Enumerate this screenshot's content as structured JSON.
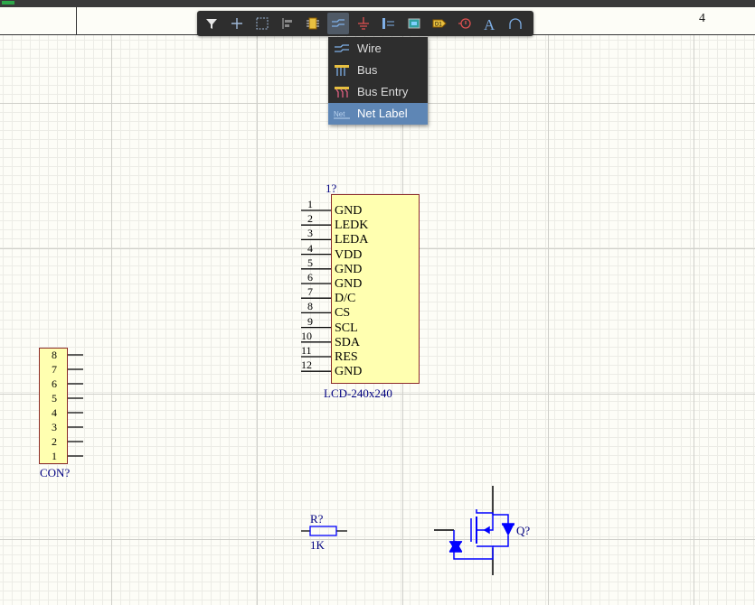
{
  "title_block": {
    "sheet_zone": "4"
  },
  "toolbar": {
    "buttons": [
      "filter-icon",
      "cross-icon",
      "select-rect-icon",
      "align-icon",
      "part-icon",
      "wire-icon",
      "gnd-icon",
      "port-icon",
      "sheet-icon",
      "netlabel-icon",
      "directive-icon",
      "text-icon",
      "arc-icon"
    ]
  },
  "wire_menu": {
    "items": [
      {
        "label": "Wire",
        "icon": "wire-icon"
      },
      {
        "label": "Bus",
        "icon": "bus-icon"
      },
      {
        "label": "Bus Entry",
        "icon": "bus-entry-icon"
      },
      {
        "label": "Net Label",
        "icon": "net-label-icon",
        "selected": true
      }
    ]
  },
  "lcd": {
    "designator": "1?",
    "comment": "LCD-240x240",
    "pins": [
      {
        "num": "1",
        "name": "GND"
      },
      {
        "num": "2",
        "name": "LEDK"
      },
      {
        "num": "3",
        "name": "LEDA"
      },
      {
        "num": "4",
        "name": "VDD"
      },
      {
        "num": "5",
        "name": "GND"
      },
      {
        "num": "6",
        "name": "GND"
      },
      {
        "num": "7",
        "name": "D/C"
      },
      {
        "num": "8",
        "name": "CS"
      },
      {
        "num": "9",
        "name": "SCL"
      },
      {
        "num": "10",
        "name": "SDA"
      },
      {
        "num": "11",
        "name": "RES"
      },
      {
        "num": "12",
        "name": "GND"
      }
    ]
  },
  "connector": {
    "designator": "CON?",
    "pins": [
      "8",
      "7",
      "6",
      "5",
      "4",
      "3",
      "2",
      "1"
    ]
  },
  "resistor": {
    "designator": "R?",
    "value": "1K"
  },
  "mosfet": {
    "designator": "Q?"
  },
  "colors": {
    "component_text": "#000080",
    "body_fill": "#ffffb0",
    "body_border": "#8b2a2a",
    "wire_blue": "#0000ff",
    "menu_selected": "#5e86b5"
  }
}
